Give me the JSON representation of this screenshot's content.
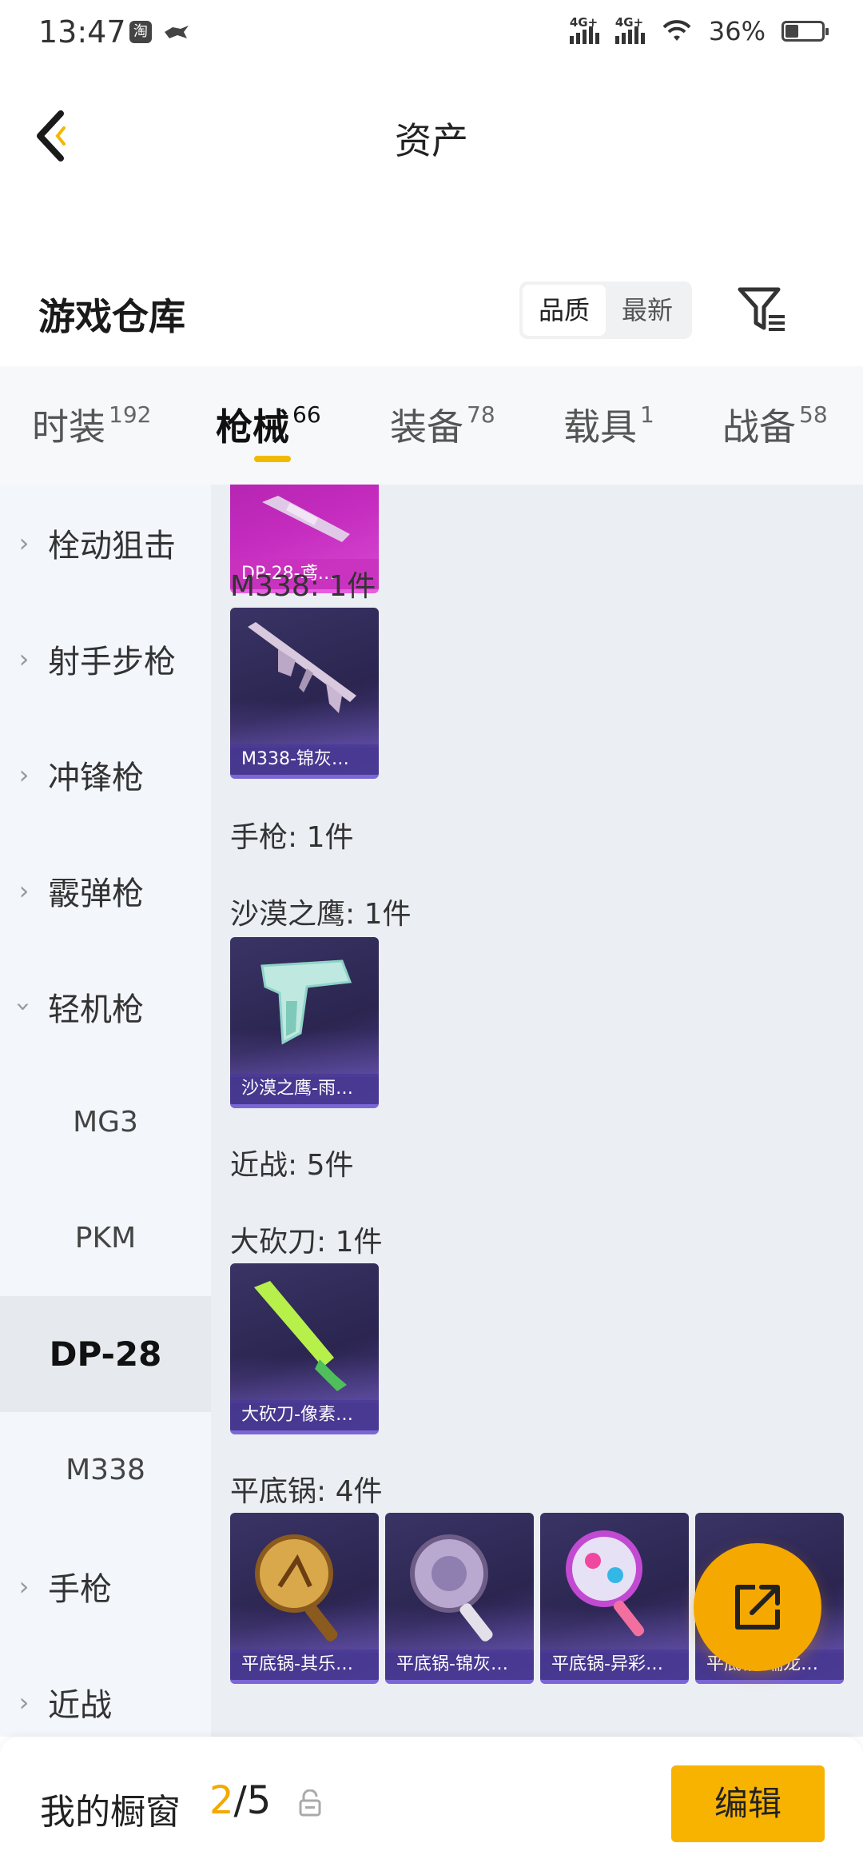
{
  "status_bar": {
    "time": "13:47",
    "app_icons": [
      "淘"
    ],
    "network1": "4G+",
    "network2": "4G+",
    "battery_pct": "36%",
    "battery_level": 0.36
  },
  "header": {
    "title": "资产"
  },
  "section": {
    "title": "游戏仓库",
    "sort_options": [
      "品质",
      "最新"
    ],
    "sort_selected": "品质"
  },
  "tabs": [
    {
      "label": "时装",
      "count": "192"
    },
    {
      "label": "枪械",
      "count": "66"
    },
    {
      "label": "装备",
      "count": "78"
    },
    {
      "label": "载具",
      "count": "1"
    },
    {
      "label": "战备",
      "count": "58"
    }
  ],
  "active_tab": "枪械",
  "sidebar": {
    "items": [
      {
        "label": "栓动狙击",
        "expanded": false
      },
      {
        "label": "射手步枪",
        "expanded": false
      },
      {
        "label": "冲锋枪",
        "expanded": false
      },
      {
        "label": "霰弹枪",
        "expanded": false
      },
      {
        "label": "轻机枪",
        "expanded": true
      },
      {
        "label": "MG3"
      },
      {
        "label": "PKM"
      },
      {
        "label": "DP-28",
        "selected": true
      },
      {
        "label": "M338"
      },
      {
        "label": "手枪",
        "expanded": false
      },
      {
        "label": "近战",
        "expanded": false
      }
    ]
  },
  "content": {
    "cards": {
      "dp28": "DP-28-鸢…",
      "m338": "M338-锦灰…",
      "deagle": "沙漠之鹰-雨…",
      "machete": "大砍刀-像素…",
      "pan1": "平底锅-其乐…",
      "pan2": "平底锅-锦灰…",
      "pan3": "平底锅-异彩…",
      "pan4": "平底锅-瑞龙…"
    },
    "labels": {
      "m338": "M338: 1件",
      "pistol": "手枪: 1件",
      "deagle": "沙漠之鹰: 1件",
      "melee": "近战: 5件",
      "machete": "大砍刀: 1件",
      "pan": "平底锅: 4件"
    }
  },
  "bottom_bar": {
    "label": "我的橱窗",
    "current": "2",
    "total": "/5",
    "edit_label": "编辑"
  },
  "colors": {
    "accent": "#f8b200",
    "card_purple": "#2b2550",
    "card_pink": "#c52cbf"
  }
}
